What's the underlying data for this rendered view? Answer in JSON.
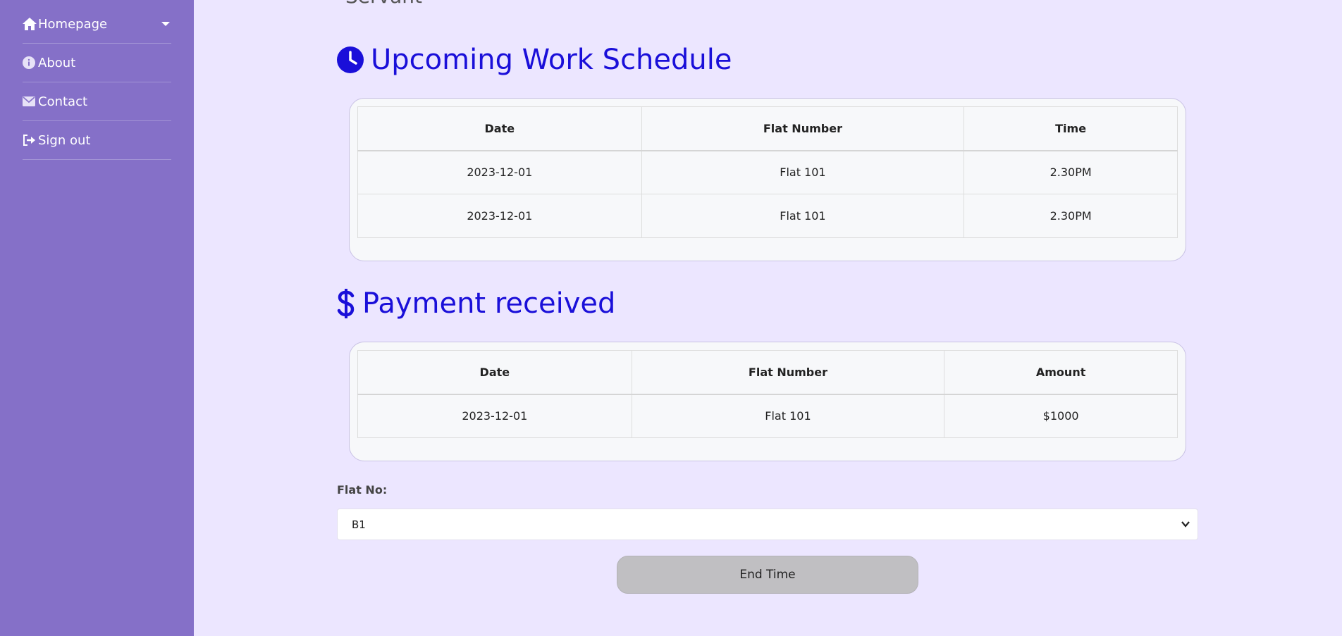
{
  "sidebar": {
    "items": [
      {
        "label": "Homepage",
        "icon": "home-icon"
      },
      {
        "label": "About",
        "icon": "info-icon"
      },
      {
        "label": "Contact",
        "icon": "envelope-icon"
      },
      {
        "label": "Sign out",
        "icon": "sign-out-icon"
      }
    ]
  },
  "page": {
    "cut_heading": "Servant"
  },
  "schedule": {
    "title": "Upcoming Work Schedule",
    "icon": "clock-icon",
    "columns": [
      "Date",
      "Flat Number",
      "Time"
    ],
    "rows": [
      [
        "2023-12-01",
        "Flat 101",
        "2.30PM"
      ],
      [
        "2023-12-01",
        "Flat 101",
        "2.30PM"
      ]
    ]
  },
  "payment": {
    "title": "Payment received",
    "icon": "dollar-icon",
    "columns": [
      "Date",
      "Flat Number",
      "Amount"
    ],
    "rows": [
      [
        "2023-12-01",
        "Flat 101",
        "$1000"
      ]
    ]
  },
  "form": {
    "flat_label": "Flat No:",
    "flat_selected": "B1",
    "end_button": "End Time"
  },
  "colors": {
    "sidebar": "#8570c8",
    "background": "#ece6ff",
    "heading": "#1a0fd9",
    "button": "#c0bfc2"
  }
}
